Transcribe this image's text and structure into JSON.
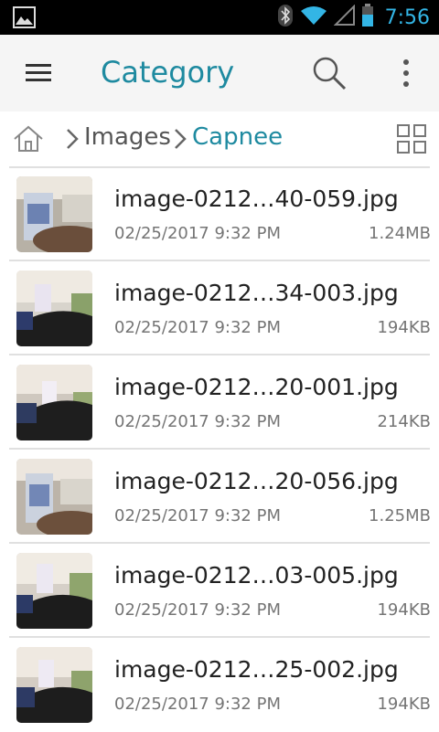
{
  "status_bar": {
    "time": "7:56",
    "icons": [
      "gallery-icon",
      "bluetooth-icon",
      "wifi-icon",
      "signal-icon",
      "battery-icon"
    ]
  },
  "app_bar": {
    "title": "Category",
    "icons": [
      "menu-icon",
      "search-icon",
      "more-vert-icon"
    ]
  },
  "breadcrumb": {
    "home_icon": "home-icon",
    "items": [
      "Images",
      "Capnee"
    ],
    "view_toggle_icon": "grid-view-icon"
  },
  "files": [
    {
      "name": "image-0212…40-059.jpg",
      "date": "02/25/2017 9:32 PM",
      "size": "1.24MB"
    },
    {
      "name": "image-0212…34-003.jpg",
      "date": "02/25/2017 9:32 PM",
      "size": "194KB"
    },
    {
      "name": "image-0212…20-001.jpg",
      "date": "02/25/2017 9:32 PM",
      "size": "214KB"
    },
    {
      "name": "image-0212…20-056.jpg",
      "date": "02/25/2017 9:32 PM",
      "size": "1.25MB"
    },
    {
      "name": "image-0212…03-005.jpg",
      "date": "02/25/2017 9:32 PM",
      "size": "194KB"
    },
    {
      "name": "image-0212…25-002.jpg",
      "date": "02/25/2017 9:32 PM",
      "size": "194KB"
    }
  ],
  "colors": {
    "accent": "#1e8aa0",
    "status_time": "#33b5e5",
    "app_bar_bg": "#f5f5f5"
  }
}
